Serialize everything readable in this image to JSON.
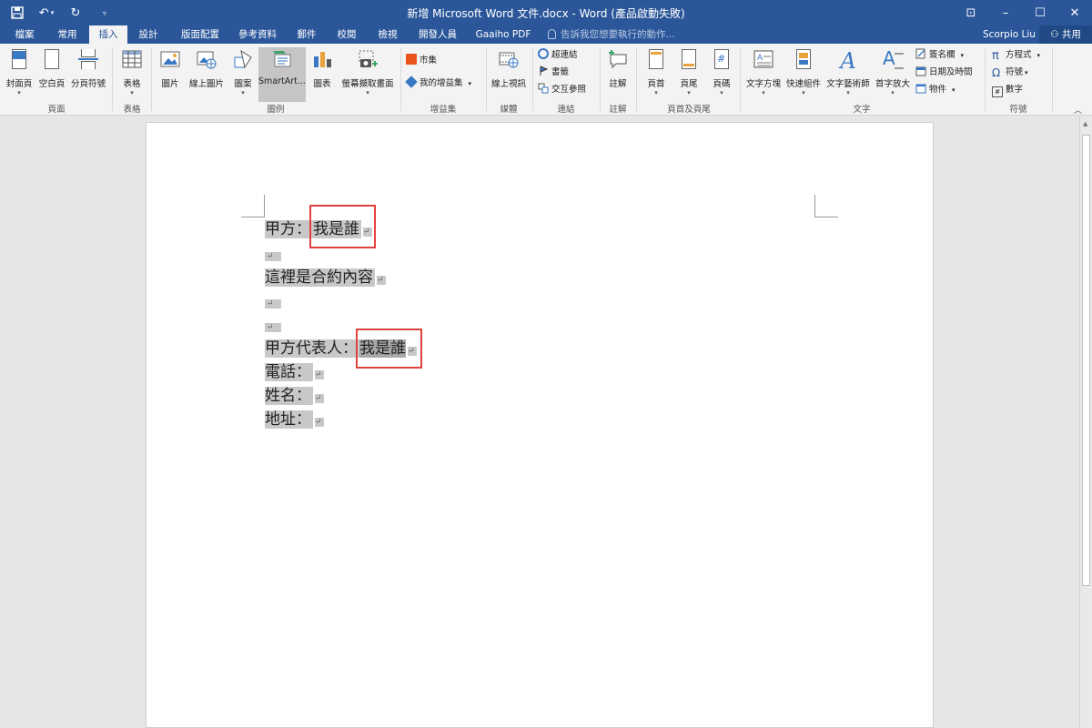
{
  "window": {
    "title": "新增 Microsoft Word 文件.docx - Word (產品啟動失敗)",
    "controls": [
      "⊡",
      "–",
      "☐",
      "✕"
    ]
  },
  "tabs": [
    "檔案",
    "常用",
    "插入",
    "設計",
    "版面配置",
    "參考資料",
    "郵件",
    "校閱",
    "檢視",
    "開發人員",
    "Gaaiho PDF"
  ],
  "tell_me": "告訴我您想要執行的動作...",
  "user": "Scorpio Liu",
  "share": "共用",
  "ribbon": {
    "pages": {
      "cover": "封面頁",
      "blank": "空白頁",
      "break": "分頁符號",
      "group": "頁面"
    },
    "tables": {
      "table": "表格",
      "group": "表格"
    },
    "illustrations": {
      "picture": "圖片",
      "online_picture": "線上圖片",
      "shapes": "圖案",
      "smartart": "SmartArt...",
      "chart": "圖表",
      "screenshot": "螢幕擷取畫面",
      "group": "圖例"
    },
    "addins": {
      "store": "市集",
      "my_addins": "我的增益集",
      "group": "增益集"
    },
    "media": {
      "online_video": "線上視訊",
      "group": "媒體"
    },
    "links": {
      "hyperlink": "超連結",
      "bookmark": "書籤",
      "crossref": "交互參照",
      "group": "連結"
    },
    "comments": {
      "comment": "註解",
      "group": "註解"
    },
    "header_footer": {
      "header": "頁首",
      "footer": "頁尾",
      "page_number": "頁碼",
      "group": "頁首及頁尾"
    },
    "text": {
      "textbox": "文字方塊",
      "quickparts": "快速組件",
      "wordart": "文字藝術師",
      "dropcap": "首字放大",
      "signature": "簽名欄",
      "datetime": "日期及時間",
      "object": "物件",
      "group": "文字"
    },
    "symbols": {
      "equation": "方程式",
      "symbol": "符號",
      "number": "數字",
      "group": "符號"
    }
  },
  "document": {
    "line1_prefix": "甲方：",
    "line1_field": "我是誰",
    "line3": "這裡是合約內容",
    "line6_prefix": "甲方代表人：",
    "line6_field": "我是誰",
    "line7": "電話：",
    "line8": "姓名：",
    "line9": "地址：",
    "para_mark": "↵"
  },
  "colors": {
    "accent": "#2b579a",
    "highlight_box": "#e0413d",
    "field_shading": "#c8c8c8"
  }
}
